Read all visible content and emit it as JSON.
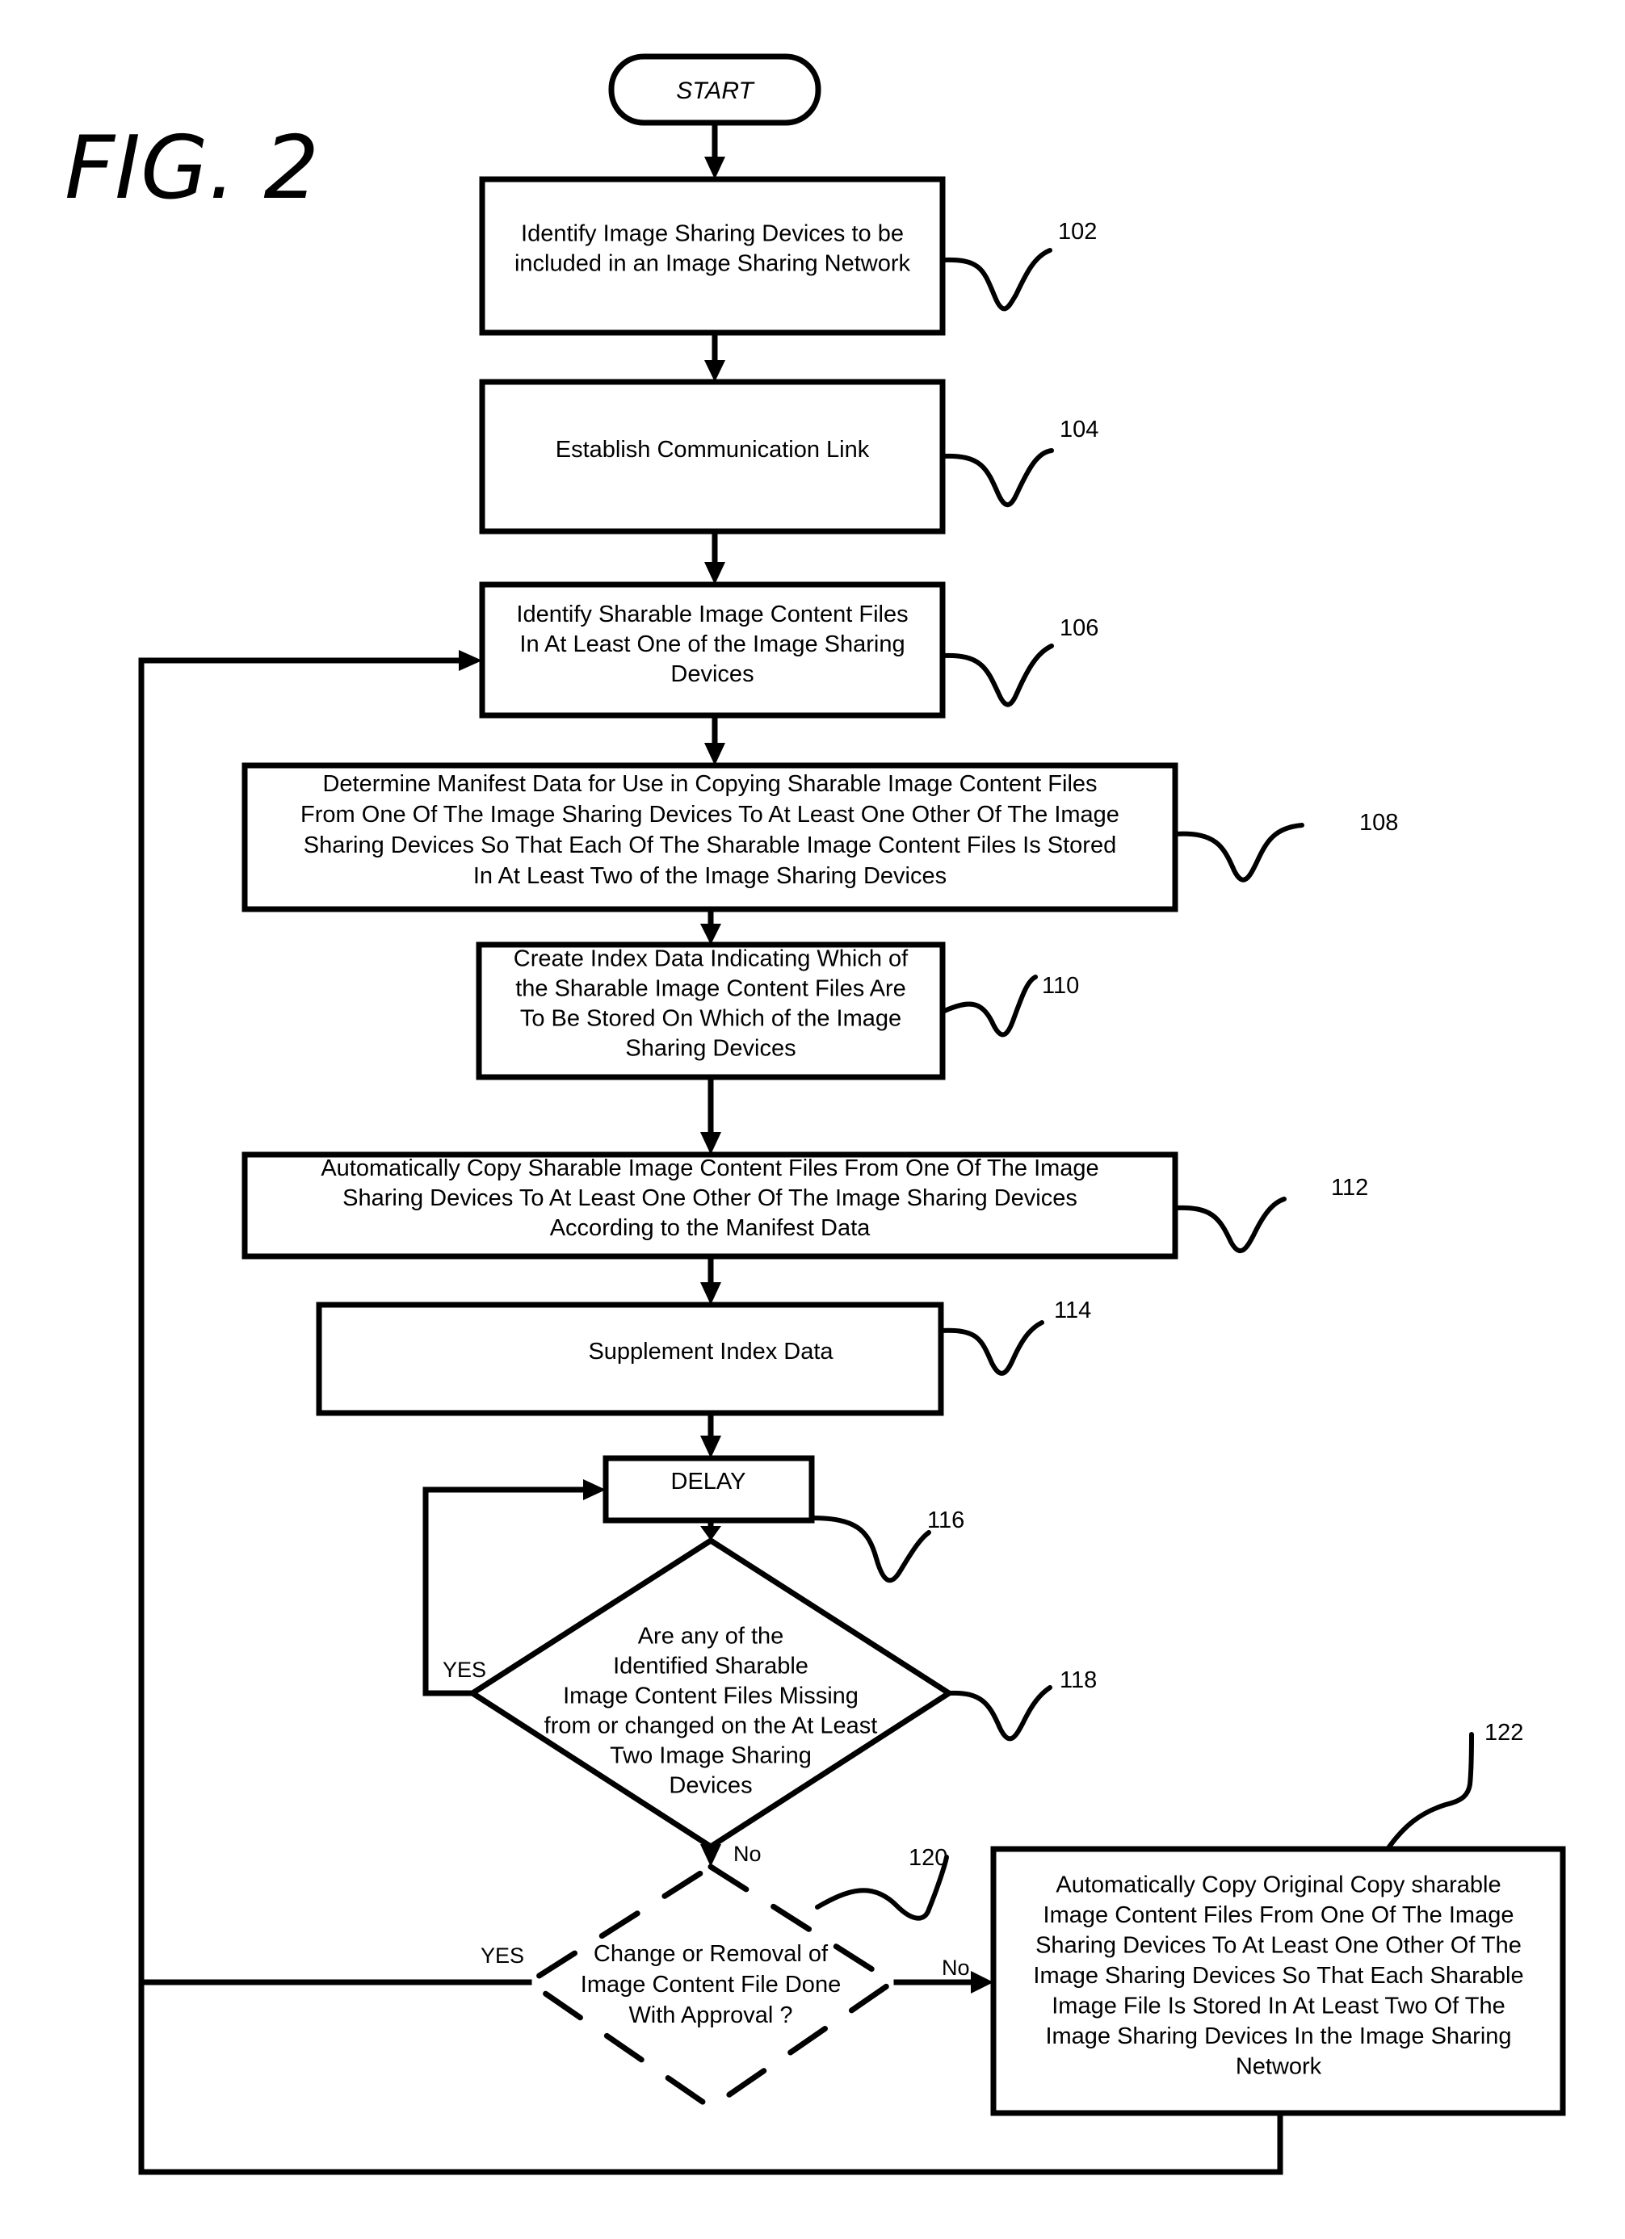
{
  "figure_label": "FIG. 2",
  "start": {
    "label": "START"
  },
  "nodes": [
    {
      "id": "102",
      "type": "process",
      "ref": "102",
      "lines": [
        "Identify Image Sharing Devices to be",
        "included in an Image Sharing Network"
      ]
    },
    {
      "id": "104",
      "type": "process",
      "ref": "104",
      "lines": [
        "Establish Communication Link"
      ]
    },
    {
      "id": "106",
      "type": "process",
      "ref": "106",
      "lines": [
        "Identify Sharable Image Content Files",
        "In At Least One of the Image Sharing",
        "Devices"
      ]
    },
    {
      "id": "108",
      "type": "process",
      "ref": "108",
      "lines": [
        "Determine Manifest Data for Use in Copying Sharable Image Content Files",
        "From One Of The Image Sharing Devices To At Least One Other Of The Image",
        "Sharing Devices So That Each Of The Sharable Image Content Files Is Stored",
        "In At Least Two of the Image Sharing Devices"
      ]
    },
    {
      "id": "110",
      "type": "process",
      "ref": "110",
      "lines": [
        "Create Index Data Indicating Which of",
        "the Sharable Image Content Files Are",
        "To Be Stored On Which of the Image",
        "Sharing Devices"
      ]
    },
    {
      "id": "112",
      "type": "process",
      "ref": "112",
      "lines": [
        "Automatically Copy Sharable Image Content Files From One Of The Image",
        "Sharing Devices To At Least One Other Of The Image Sharing Devices",
        "According to the Manifest Data"
      ]
    },
    {
      "id": "114",
      "type": "process",
      "ref": "114",
      "lines": [
        "Supplement Index Data"
      ]
    },
    {
      "id": "116",
      "type": "process",
      "ref": "116",
      "lines": [
        "DELAY"
      ]
    },
    {
      "id": "118",
      "type": "decision",
      "ref": "118",
      "lines": [
        "Are any of the",
        "Identified Sharable",
        "Image Content Files Missing",
        "from or changed on the At Least",
        "Two Image Sharing",
        "Devices"
      ]
    },
    {
      "id": "120",
      "type": "decision-dashed",
      "ref": "120",
      "lines": [
        "Change or Removal of",
        "Image Content File Done",
        "With Approval ?"
      ]
    },
    {
      "id": "122",
      "type": "process",
      "ref": "122",
      "lines": [
        "Automatically Copy Original Copy  sharable",
        "Image Content Files From One Of The Image",
        "Sharing Devices To At Least One Other Of The",
        "Image Sharing Devices So That Each Sharable",
        "Image File Is Stored In At Least Two Of The",
        "Image Sharing Devices In the Image Sharing",
        "Network"
      ]
    }
  ],
  "edges": [
    {
      "from": "start",
      "to": "102",
      "label": ""
    },
    {
      "from": "102",
      "to": "104",
      "label": ""
    },
    {
      "from": "104",
      "to": "106",
      "label": ""
    },
    {
      "from": "106",
      "to": "108",
      "label": ""
    },
    {
      "from": "108",
      "to": "110",
      "label": ""
    },
    {
      "from": "110",
      "to": "112",
      "label": ""
    },
    {
      "from": "112",
      "to": "114",
      "label": ""
    },
    {
      "from": "114",
      "to": "116",
      "label": ""
    },
    {
      "from": "116",
      "to": "118",
      "label": ""
    },
    {
      "from": "118",
      "to": "116",
      "label": "YES"
    },
    {
      "from": "118",
      "to": "120",
      "label": "No"
    },
    {
      "from": "120",
      "to": "106",
      "label": "YES"
    },
    {
      "from": "120",
      "to": "122",
      "label": "No"
    },
    {
      "from": "122",
      "to": "106",
      "label": ""
    }
  ]
}
